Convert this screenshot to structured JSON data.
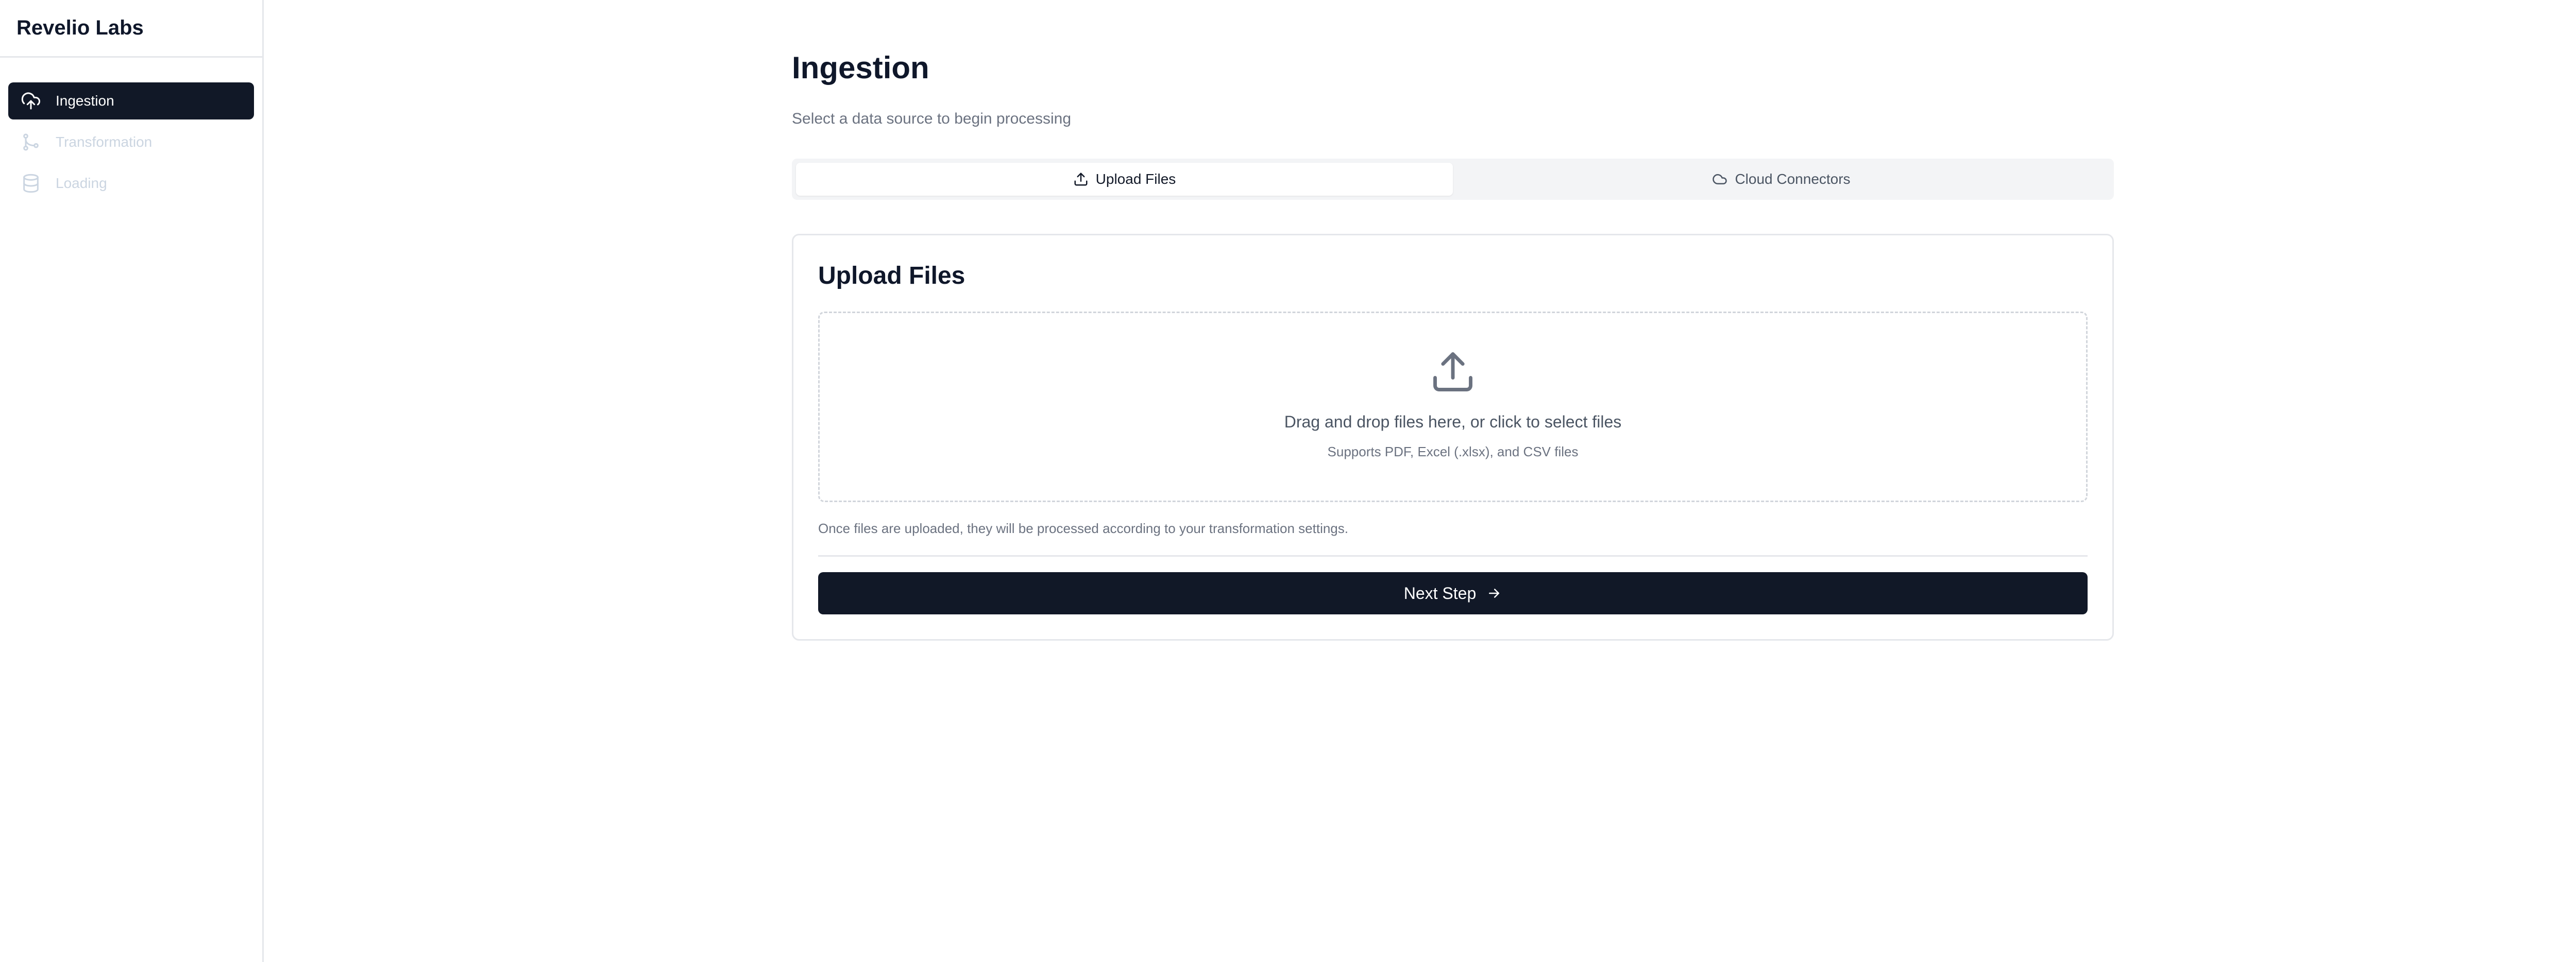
{
  "app": {
    "brand": "Revelio Labs"
  },
  "sidebar": {
    "items": [
      {
        "label": "Ingestion",
        "icon": "cloud-upload-icon",
        "active": true
      },
      {
        "label": "Transformation",
        "icon": "git-branch-icon",
        "active": false
      },
      {
        "label": "Loading",
        "icon": "database-icon",
        "active": false
      }
    ]
  },
  "page": {
    "title": "Ingestion",
    "subtitle": "Select a data source to begin processing"
  },
  "tabs": [
    {
      "label": "Upload Files",
      "icon": "upload-icon",
      "active": true
    },
    {
      "label": "Cloud Connectors",
      "icon": "cloud-icon",
      "active": false
    }
  ],
  "upload_card": {
    "title": "Upload Files",
    "drop_main": "Drag and drop files here, or click to select files",
    "drop_sub": "Supports PDF, Excel (.xlsx), and CSV files",
    "helper": "Once files are uploaded, they will be processed according to your transformation settings.",
    "next_label": "Next Step"
  },
  "colors": {
    "primary": "#111827",
    "muted_text": "#6b7280",
    "disabled_text": "#cbd5e1",
    "border": "#e5e7eb",
    "tab_bg": "#f3f4f6"
  }
}
